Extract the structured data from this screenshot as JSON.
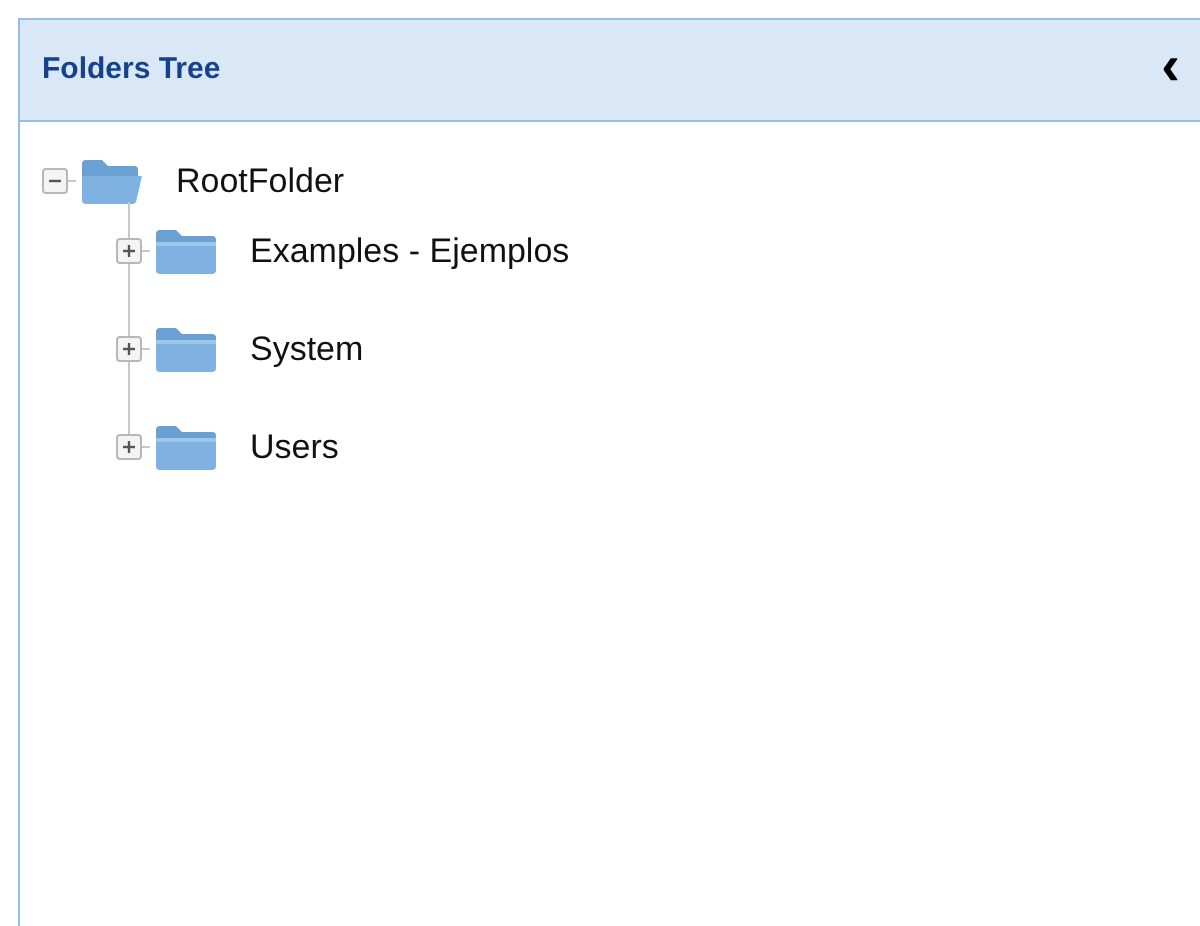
{
  "panel": {
    "title": "Folders Tree",
    "collapse_glyph": "‹"
  },
  "tree": [
    {
      "label": "RootFolder",
      "expanded": true,
      "children": [
        {
          "label": "Examples - Ejemplos",
          "expanded": false
        },
        {
          "label": "System",
          "expanded": false
        },
        {
          "label": "Users",
          "expanded": false
        }
      ]
    }
  ]
}
